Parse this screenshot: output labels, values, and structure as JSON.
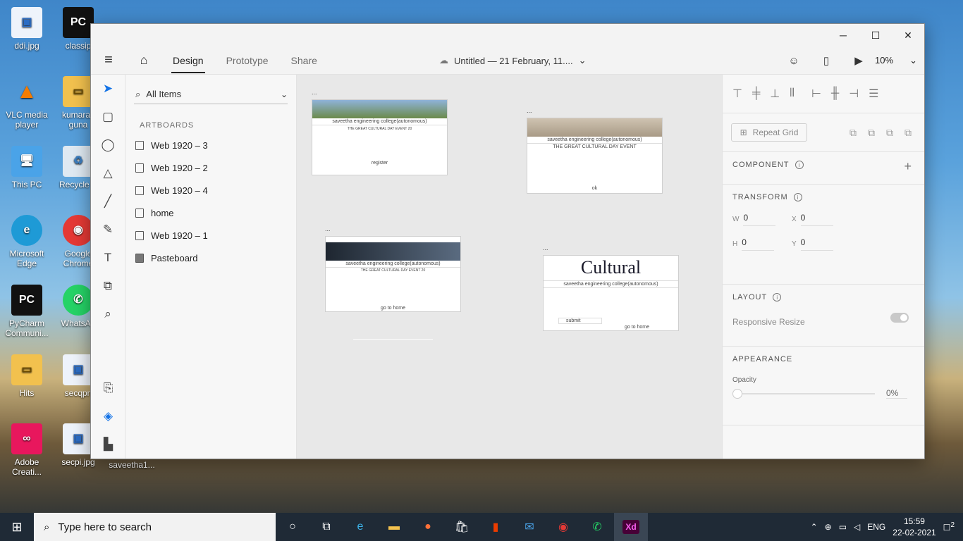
{
  "desktop": {
    "icons": [
      {
        "label": "ddi.jpg"
      },
      {
        "label": "classip"
      },
      {
        "label": "VLC media player"
      },
      {
        "label": "kumarav guna"
      },
      {
        "label": "This PC"
      },
      {
        "label": "Recycle B"
      },
      {
        "label": "Microsoft Edge"
      },
      {
        "label": "Google Chrome"
      },
      {
        "label": "PyCharm Communi..."
      },
      {
        "label": "WhatsAp"
      },
      {
        "label": "Hits"
      },
      {
        "label": "secqpn"
      },
      {
        "label": "Adobe Creati..."
      },
      {
        "label": "secpi.jpg"
      },
      {
        "label": "saveetha1..."
      }
    ]
  },
  "window": {
    "controls": {
      "minimize": "─",
      "maximize": "☐",
      "close": "✕"
    }
  },
  "appbar": {
    "tabs": [
      {
        "label": "Design"
      },
      {
        "label": "Prototype"
      },
      {
        "label": "Share"
      }
    ],
    "doc_title": "Untitled — 21 February, 11....",
    "zoom": "10%"
  },
  "layers": {
    "search_label": "All Items",
    "section": "ARTBOARDS",
    "items": [
      {
        "label": "Web 1920 – 3"
      },
      {
        "label": "Web 1920 – 2"
      },
      {
        "label": "Web 1920 – 4"
      },
      {
        "label": "home"
      },
      {
        "label": "Web 1920 – 1"
      },
      {
        "label": "Pasteboard"
      }
    ]
  },
  "canvas": {
    "artboards": [
      {
        "name": "...",
        "college": "saveetha engineering college(autonomous)",
        "event": "THE GREAT CULTURAL DAY EVENT 20",
        "button": "register"
      },
      {
        "name": "...",
        "college": "saveetha engineering college(autonomous)",
        "event": "THE GREAT CULTURAL DAY EVENT",
        "button": "ok"
      },
      {
        "name": "...",
        "college": "saveetha engineering college(autonomous)",
        "event": "THE GREAT CULTURAL DAY EVENT 20",
        "button": "go to home"
      },
      {
        "name": "...",
        "college": "saveetha engineering college(autonomous)",
        "banner": "Cultural",
        "submit": "submit",
        "button": "go to home"
      }
    ]
  },
  "props": {
    "repeat_grid": "Repeat Grid",
    "component": "COMPONENT",
    "transform": "TRANSFORM",
    "w_label": "W",
    "w": "0",
    "x_label": "X",
    "x": "0",
    "h_label": "H",
    "h": "0",
    "y_label": "Y",
    "y": "0",
    "layout": "LAYOUT",
    "responsive": "Responsive Resize",
    "appearance": "APPEARANCE",
    "opacity_label": "Opacity",
    "opacity": "0%"
  },
  "taskbar": {
    "search_placeholder": "Type here to search",
    "lang": "ENG",
    "time": "15:59",
    "date": "22-02-2021",
    "notifications": "2"
  }
}
